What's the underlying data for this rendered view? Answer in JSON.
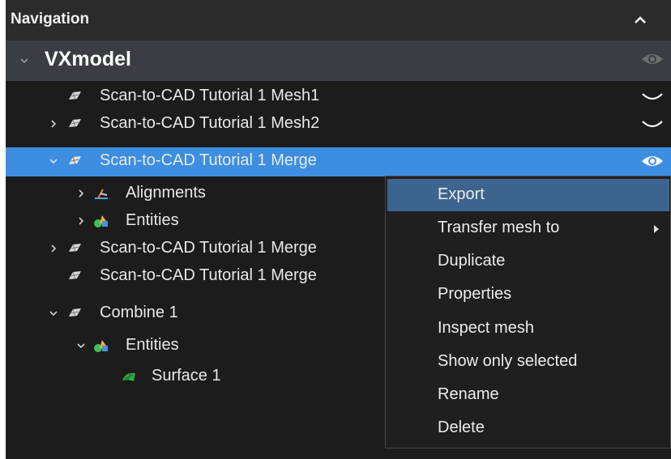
{
  "panel": {
    "title": "Navigation"
  },
  "tree": {
    "root": {
      "label": "VXmodel",
      "visible": true
    },
    "nodes": [
      {
        "label": "Scan-to-CAD Tutorial 1 Mesh1",
        "expandable": false,
        "visibility": "hidden"
      },
      {
        "label": "Scan-to-CAD Tutorial 1 Mesh2",
        "expandable": true,
        "expanded": false,
        "visibility": "hidden"
      },
      {
        "label": "Scan-to-CAD Tutorial 1 Merge",
        "expandable": true,
        "expanded": true,
        "selected": true,
        "visibility": "visible"
      },
      {
        "label": "Alignments",
        "expandable": true,
        "expanded": false
      },
      {
        "label": "Entities",
        "expandable": true,
        "expanded": false
      },
      {
        "label": "Scan-to-CAD Tutorial 1 Merge",
        "expandable": true,
        "expanded": false
      },
      {
        "label": "Scan-to-CAD Tutorial 1 Merge",
        "expandable": false
      },
      {
        "label": "Combine 1",
        "expandable": true,
        "expanded": true
      },
      {
        "label": "Entities",
        "expandable": true,
        "expanded": true
      },
      {
        "label": "Surface 1",
        "expandable": false
      }
    ]
  },
  "context_menu": {
    "items": [
      {
        "label": "Export",
        "highlighted": true
      },
      {
        "label": "Transfer mesh to",
        "has_submenu": true
      },
      {
        "label": "Duplicate"
      },
      {
        "label": "Properties"
      },
      {
        "label": "Inspect mesh"
      },
      {
        "label": "Show only selected"
      },
      {
        "label": "Rename"
      },
      {
        "label": "Delete"
      }
    ]
  },
  "colors": {
    "panel_bg": "#1c1c1c",
    "header_bg": "#2b2b2b",
    "root_bg": "#3a3e44",
    "selection": "#3d8ee0",
    "menu_hover": "#3d648f"
  }
}
